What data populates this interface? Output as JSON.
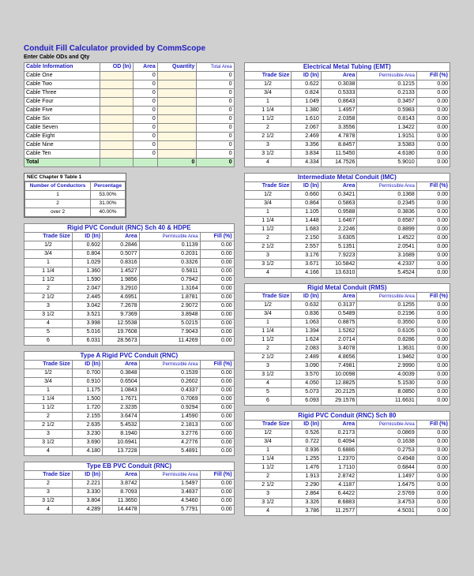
{
  "title": "Conduit Fill Calculator provided by CommScope",
  "subtitle": "Enter Cable ODs and Qty",
  "cableInfo": {
    "headers": [
      "Cable Information",
      "OD (In)",
      "Area",
      "Quantity",
      "Total Area"
    ],
    "rows": [
      {
        "name": "Cable One",
        "od": "",
        "area": "0",
        "qty": "",
        "total": "0"
      },
      {
        "name": "Cable Two",
        "od": "",
        "area": "0",
        "qty": "",
        "total": "0"
      },
      {
        "name": "Cable Three",
        "od": "",
        "area": "0",
        "qty": "",
        "total": "0"
      },
      {
        "name": "Cable Four",
        "od": "",
        "area": "0",
        "qty": "",
        "total": "0"
      },
      {
        "name": "Cable Five",
        "od": "",
        "area": "0",
        "qty": "",
        "total": "0"
      },
      {
        "name": "Cable Six",
        "od": "",
        "area": "0",
        "qty": "",
        "total": "0"
      },
      {
        "name": "Cable Seven",
        "od": "",
        "area": "0",
        "qty": "",
        "total": "0"
      },
      {
        "name": "Cable Eight",
        "od": "",
        "area": "0",
        "qty": "",
        "total": "0"
      },
      {
        "name": "Cable Nine",
        "od": "",
        "area": "0",
        "qty": "",
        "total": "0"
      },
      {
        "name": "Cable Ten",
        "od": "",
        "area": "0",
        "qty": "",
        "total": "0"
      }
    ],
    "totalRow": {
      "label": "Total",
      "qty": "0",
      "total": "0"
    }
  },
  "nec": {
    "title": "NEC Chapter 9 Table 1",
    "h1": "Number of Conductors",
    "h2": "Percentage",
    "rows": [
      [
        "1",
        "53.00%"
      ],
      [
        "2",
        "31.00%"
      ],
      [
        "over 2",
        "40.00%"
      ]
    ]
  },
  "secHeaders": [
    "Trade Size",
    "ID (In)",
    "Area",
    "Permissible Area",
    "Fill (%)"
  ],
  "leftSections": [
    {
      "title": "Rigid PVC Conduit (RNC) Sch 40 & HDPE",
      "rows": [
        [
          "1/2",
          "0.602",
          "0.2846",
          "0.1139",
          "0.00"
        ],
        [
          "3/4",
          "0.804",
          "0.5077",
          "0.2031",
          "0.00"
        ],
        [
          "1",
          "1.029",
          "0.8316",
          "0.3326",
          "0.00"
        ],
        [
          "1 1/4",
          "1.360",
          "1.4527",
          "0.5811",
          "0.00"
        ],
        [
          "1 1/2",
          "1.590",
          "1.9856",
          "0.7942",
          "0.00"
        ],
        [
          "2",
          "2.047",
          "3.2910",
          "1.3164",
          "0.00"
        ],
        [
          "2 1/2",
          "2.445",
          "4.6951",
          "1.8781",
          "0.00"
        ],
        [
          "3",
          "3.042",
          "7.2678",
          "2.9072",
          "0.00"
        ],
        [
          "3 1/2",
          "3.521",
          "9.7369",
          "3.8948",
          "0.00"
        ],
        [
          "4",
          "3.998",
          "12.5538",
          "5.0215",
          "0.00"
        ],
        [
          "5",
          "5.016",
          "19.7608",
          "7.9043",
          "0.00"
        ],
        [
          "6",
          "6.031",
          "28.5673",
          "11.4269",
          "0.00"
        ]
      ]
    },
    {
      "title": "Type A Rigid PVC Conduit (RNC)",
      "rows": [
        [
          "1/2",
          "0.700",
          "0.3848",
          "0.1539",
          "0.00"
        ],
        [
          "3/4",
          "0.910",
          "0.6504",
          "0.2602",
          "0.00"
        ],
        [
          "1",
          "1.175",
          "1.0843",
          "0.4337",
          "0.00"
        ],
        [
          "1 1/4",
          "1.500",
          "1.7671",
          "0.7069",
          "0.00"
        ],
        [
          "1 1/2",
          "1.720",
          "2.3235",
          "0.9294",
          "0.00"
        ],
        [
          "2",
          "2.155",
          "3.6474",
          "1.4590",
          "0.00"
        ],
        [
          "2 1/2",
          "2.635",
          "5.4532",
          "2.1813",
          "0.00"
        ],
        [
          "3",
          "3.230",
          "8.1940",
          "3.2776",
          "0.00"
        ],
        [
          "3 1/2",
          "3.690",
          "10.6941",
          "4.2776",
          "0.00"
        ],
        [
          "4",
          "4.180",
          "13.7228",
          "5.4891",
          "0.00"
        ]
      ]
    },
    {
      "title": "Type EB PVC Conduit (RNC)",
      "rows": [
        [
          "2",
          "2.221",
          "3.8742",
          "1.5497",
          "0.00"
        ],
        [
          "3",
          "3.330",
          "8.7093",
          "3.4837",
          "0.00"
        ],
        [
          "3 1/2",
          "3.804",
          "11.3650",
          "4.5460",
          "0.00"
        ],
        [
          "4",
          "4.289",
          "14.4478",
          "5.7791",
          "0.00"
        ]
      ]
    }
  ],
  "rightSections": [
    {
      "title": "Electrical Metal Tubing (EMT)",
      "rows": [
        [
          "1/2",
          "0.622",
          "0.3038",
          "0.1215",
          "0.00"
        ],
        [
          "3/4",
          "0.824",
          "0.5333",
          "0.2133",
          "0.00"
        ],
        [
          "1",
          "1.049",
          "0.8643",
          "0.3457",
          "0.00"
        ],
        [
          "1 1/4",
          "1.380",
          "1.4957",
          "0.5983",
          "0.00"
        ],
        [
          "1 1/2",
          "1.610",
          "2.0358",
          "0.8143",
          "0.00"
        ],
        [
          "2",
          "2.067",
          "3.3556",
          "1.3422",
          "0.00"
        ],
        [
          "2 1/2",
          "2.469",
          "4.7878",
          "1.9151",
          "0.00"
        ],
        [
          "3",
          "3.356",
          "8.8457",
          "3.5383",
          "0.00"
        ],
        [
          "3 1/2",
          "3.834",
          "11.5450",
          "4.6180",
          "0.00"
        ],
        [
          "4",
          "4.334",
          "14.7526",
          "5.9010",
          "0.00"
        ]
      ]
    },
    {
      "title": "Intermediate Metal Conduit (IMC)",
      "rows": [
        [
          "1/2",
          "0.660",
          "0.3421",
          "0.1368",
          "0.00"
        ],
        [
          "3/4",
          "0.864",
          "0.5863",
          "0.2345",
          "0.00"
        ],
        [
          "1",
          "1.105",
          "0.9588",
          "0.3836",
          "0.00"
        ],
        [
          "1 1/4",
          "1.448",
          "1.6467",
          "0.6587",
          "0.00"
        ],
        [
          "1 1/2",
          "1.683",
          "2.2246",
          "0.8899",
          "0.00"
        ],
        [
          "2",
          "2.150",
          "3.6305",
          "1.4522",
          "0.00"
        ],
        [
          "2 1/2",
          "2.557",
          "5.1351",
          "2.0541",
          "0.00"
        ],
        [
          "3",
          "3.176",
          "7.9223",
          "3.1689",
          "0.00"
        ],
        [
          "3 1/2",
          "3.671",
          "10.5842",
          "4.2337",
          "0.00"
        ],
        [
          "4",
          "4.166",
          "13.6310",
          "5.4524",
          "0.00"
        ]
      ]
    },
    {
      "title": "Rigid Metal Conduit (RMS)",
      "rows": [
        [
          "1/2",
          "0.632",
          "0.3137",
          "0.1255",
          "0.00"
        ],
        [
          "3/4",
          "0.836",
          "0.5489",
          "0.2196",
          "0.00"
        ],
        [
          "1",
          "1.063",
          "0.8875",
          "0.3550",
          "0.00"
        ],
        [
          "1 1/4",
          "1.394",
          "1.5262",
          "0.6105",
          "0.00"
        ],
        [
          "1 1/2",
          "1.624",
          "2.0714",
          "0.8286",
          "0.00"
        ],
        [
          "2",
          "2.083",
          "3.4078",
          "1.3631",
          "0.00"
        ],
        [
          "2 1/2",
          "2.489",
          "4.8656",
          "1.9462",
          "0.00"
        ],
        [
          "3",
          "3.090",
          "7.4981",
          "2.9990",
          "0.00"
        ],
        [
          "3 1/2",
          "3.570",
          "10.0098",
          "4.0039",
          "0.00"
        ],
        [
          "4",
          "4.050",
          "12.8825",
          "5.1530",
          "0.00"
        ],
        [
          "5",
          "5.073",
          "20.2125",
          "8.0850",
          "0.00"
        ],
        [
          "6",
          "6.093",
          "29.1576",
          "11.6631",
          "0.00"
        ]
      ]
    },
    {
      "title": "Rigid PVC Conduit (RNC) Sch 80",
      "rows": [
        [
          "1/2",
          "0.526",
          "0.2173",
          "0.0869",
          "0.00"
        ],
        [
          "3/4",
          "0.722",
          "0.4094",
          "0.1638",
          "0.00"
        ],
        [
          "1",
          "0.936",
          "0.6886",
          "0.2753",
          "0.00"
        ],
        [
          "1 1/4",
          "1.255",
          "1.2370",
          "0.4948",
          "0.00"
        ],
        [
          "1 1/2",
          "1.476",
          "1.7110",
          "0.6844",
          "0.00"
        ],
        [
          "2",
          "1.913",
          "2.8742",
          "1.1497",
          "0.00"
        ],
        [
          "2 1/2",
          "2.290",
          "4.1187",
          "1.6475",
          "0.00"
        ],
        [
          "3",
          "2.864",
          "6.4422",
          "2.5769",
          "0.00"
        ],
        [
          "3 1/2",
          "3.326",
          "8.6883",
          "3.4753",
          "0.00"
        ],
        [
          "4",
          "3.786",
          "11.2577",
          "4.5031",
          "0.00"
        ]
      ]
    }
  ]
}
